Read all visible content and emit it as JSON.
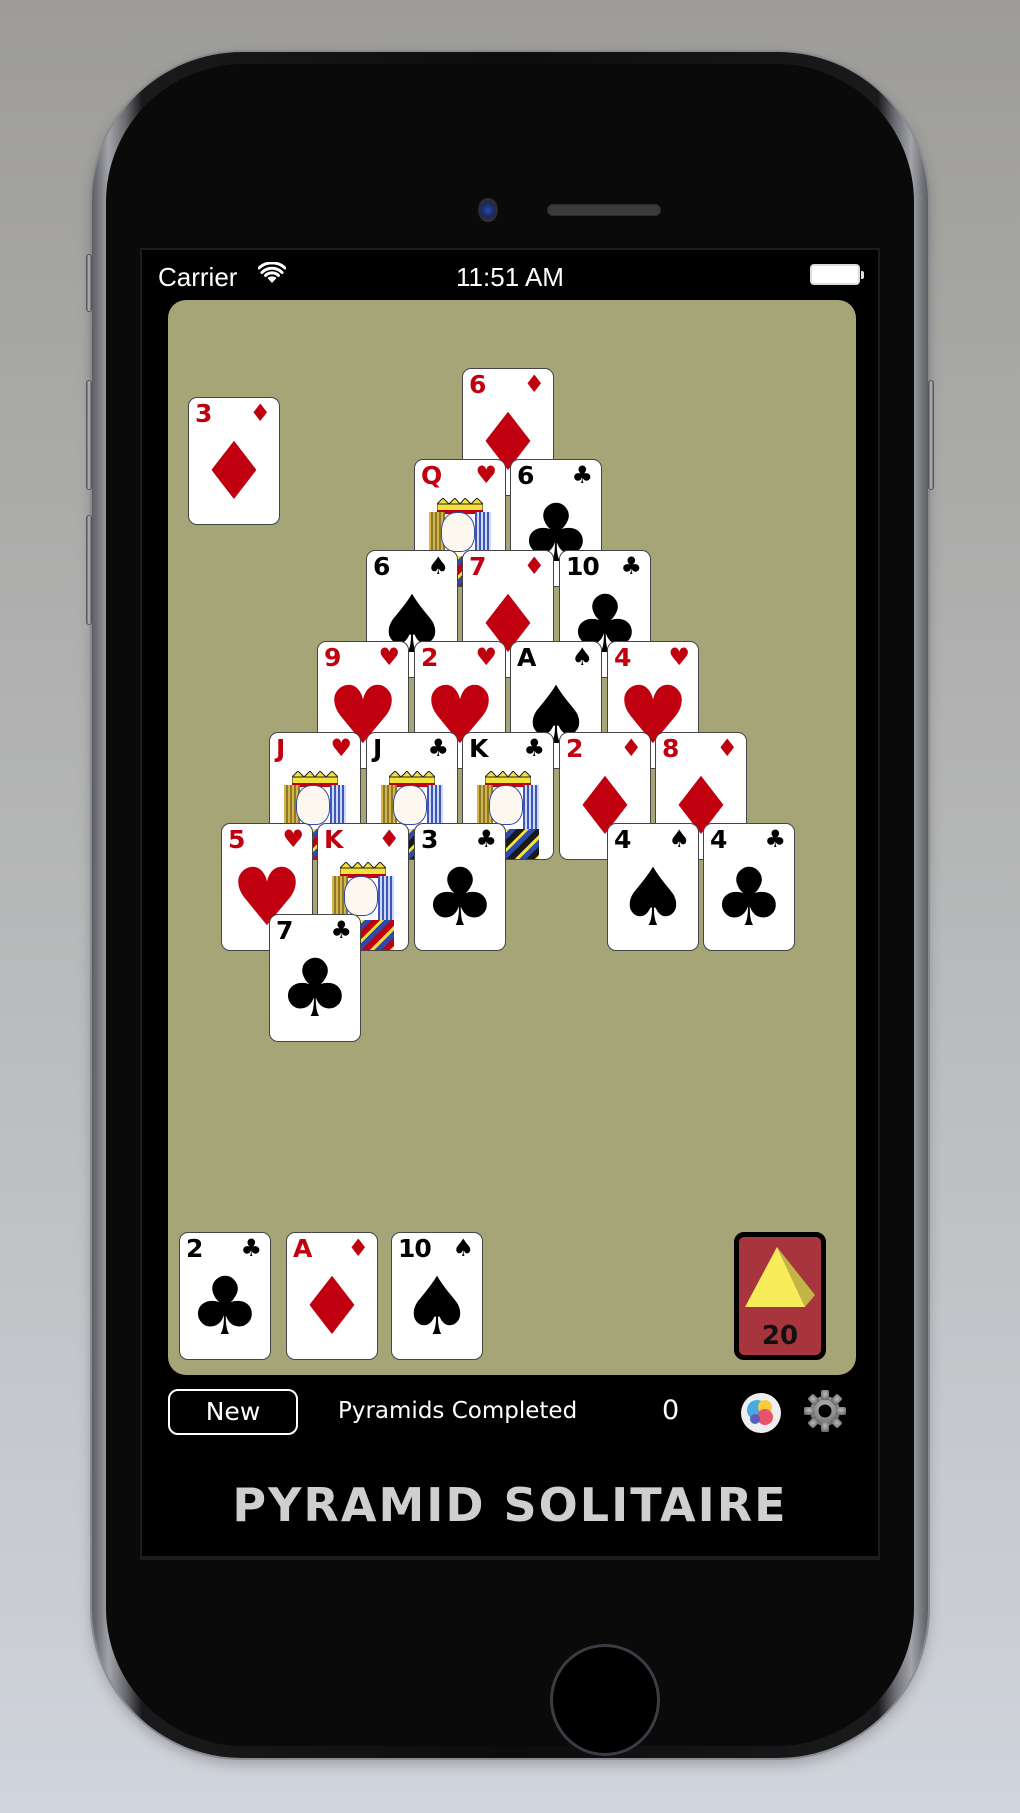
{
  "status_bar": {
    "carrier": "Carrier",
    "time": "11:51 AM",
    "wifi_icon": "wifi-icon",
    "battery_icon": "battery-full-icon"
  },
  "colors": {
    "felt": "#a6a577",
    "card_red": "#c0000f",
    "card_black": "#000000",
    "deck_back": "#a8353d",
    "deck_pyramid": "#f7ec5a",
    "title": "#cfcfcf"
  },
  "game": {
    "held_card": {
      "rank": "3",
      "suit": "diamonds",
      "symbol": "♦",
      "color": "red"
    },
    "pyramid_rows": [
      [
        {
          "rank": "6",
          "suit": "diamonds",
          "symbol": "♦",
          "color": "red"
        }
      ],
      [
        {
          "rank": "Q",
          "suit": "hearts",
          "symbol": "♥",
          "color": "red",
          "face": true
        },
        {
          "rank": "6",
          "suit": "clubs",
          "symbol": "♣",
          "color": "black"
        }
      ],
      [
        {
          "rank": "6",
          "suit": "spades",
          "symbol": "♠",
          "color": "black"
        },
        {
          "rank": "7",
          "suit": "diamonds",
          "symbol": "♦",
          "color": "red"
        },
        {
          "rank": "10",
          "suit": "clubs",
          "symbol": "♣",
          "color": "black"
        }
      ],
      [
        {
          "rank": "9",
          "suit": "hearts",
          "symbol": "♥",
          "color": "red"
        },
        {
          "rank": "2",
          "suit": "hearts",
          "symbol": "♥",
          "color": "red"
        },
        {
          "rank": "A",
          "suit": "spades",
          "symbol": "♠",
          "color": "black"
        },
        {
          "rank": "4",
          "suit": "hearts",
          "symbol": "♥",
          "color": "red"
        }
      ],
      [
        {
          "rank": "J",
          "suit": "hearts",
          "symbol": "♥",
          "color": "red",
          "face": true
        },
        {
          "rank": "J",
          "suit": "clubs",
          "symbol": "♣",
          "color": "black",
          "face": true
        },
        {
          "rank": "K",
          "suit": "clubs",
          "symbol": "♣",
          "color": "black",
          "face": true
        },
        {
          "rank": "2",
          "suit": "diamonds",
          "symbol": "♦",
          "color": "red"
        },
        {
          "rank": "8",
          "suit": "diamonds",
          "symbol": "♦",
          "color": "red"
        }
      ],
      [
        {
          "rank": "5",
          "suit": "hearts",
          "symbol": "♥",
          "color": "red"
        },
        {
          "rank": "K",
          "suit": "diamonds",
          "symbol": "♦",
          "color": "red",
          "face": true
        },
        {
          "rank": "3",
          "suit": "clubs",
          "symbol": "♣",
          "color": "black"
        },
        null,
        {
          "rank": "4",
          "suit": "spades",
          "symbol": "♠",
          "color": "black"
        },
        {
          "rank": "4",
          "suit": "clubs",
          "symbol": "♣",
          "color": "black"
        }
      ],
      [
        null,
        {
          "rank": "7",
          "suit": "clubs",
          "symbol": "♣",
          "color": "black"
        },
        null,
        null,
        null,
        null,
        null
      ]
    ],
    "waste": [
      {
        "rank": "2",
        "suit": "clubs",
        "symbol": "♣",
        "color": "black"
      },
      {
        "rank": "A",
        "suit": "diamonds",
        "symbol": "♦",
        "color": "red"
      },
      {
        "rank": "10",
        "suit": "spades",
        "symbol": "♠",
        "color": "black"
      }
    ],
    "deck": {
      "remaining": "20",
      "icon": "pyramid-icon"
    }
  },
  "toolbar": {
    "new_label": "New",
    "pyramids_label": "Pyramids Completed",
    "pyramids_count": "0",
    "gamecenter_icon": "game-center-icon",
    "settings_icon": "gear-icon"
  },
  "app_title": "PYRAMID SOLITAIRE"
}
